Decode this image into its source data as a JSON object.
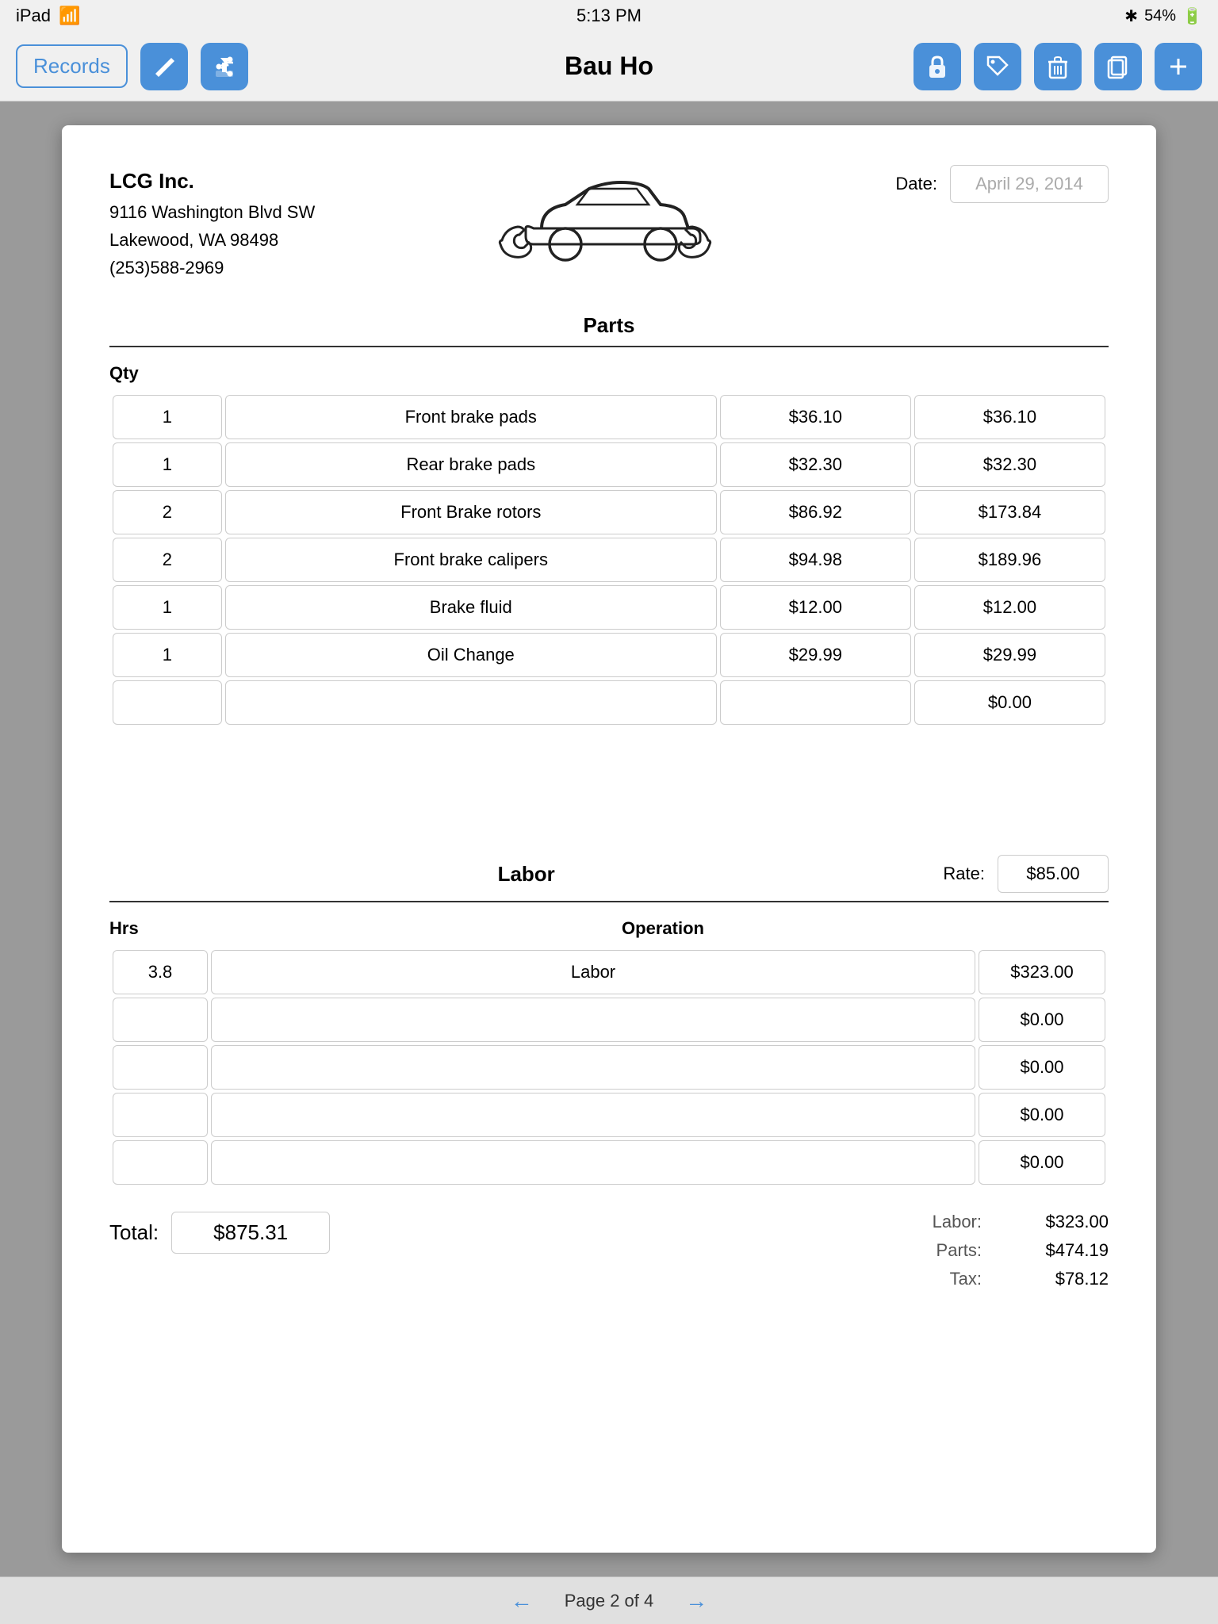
{
  "statusBar": {
    "device": "iPad",
    "wifi": "wifi",
    "time": "5:13 PM",
    "bluetooth": "bluetooth",
    "battery": "54%"
  },
  "navBar": {
    "backLabel": "Records",
    "title": "Bau Ho",
    "icons": [
      "edit",
      "share",
      "lock",
      "tag",
      "trash",
      "copy",
      "add"
    ]
  },
  "company": {
    "name": "LCG Inc.",
    "address1": "9116 Washington Blvd SW",
    "address2": "Lakewood, WA  98498",
    "phone": "(253)588-2969"
  },
  "dateLabel": "Date:",
  "dateValue": "April 29, 2014",
  "parts": {
    "sectionTitle": "Parts",
    "qtyLabel": "Qty",
    "items": [
      {
        "qty": "1",
        "desc": "Front brake pads",
        "unitPrice": "$36.10",
        "total": "$36.10"
      },
      {
        "qty": "1",
        "desc": "Rear brake pads",
        "unitPrice": "$32.30",
        "total": "$32.30"
      },
      {
        "qty": "2",
        "desc": "Front Brake rotors",
        "unitPrice": "$86.92",
        "total": "$173.84"
      },
      {
        "qty": "2",
        "desc": "Front brake calipers",
        "unitPrice": "$94.98",
        "total": "$189.96"
      },
      {
        "qty": "1",
        "desc": "Brake fluid",
        "unitPrice": "$12.00",
        "total": "$12.00"
      },
      {
        "qty": "1",
        "desc": "Oil Change",
        "unitPrice": "$29.99",
        "total": "$29.99"
      },
      {
        "qty": "",
        "desc": "",
        "unitPrice": "",
        "total": "$0.00"
      }
    ]
  },
  "labor": {
    "sectionTitle": "Labor",
    "rateLabel": "Rate:",
    "rateValue": "$85.00",
    "hrsLabel": "Hrs",
    "opLabel": "Operation",
    "items": [
      {
        "hrs": "3.8",
        "operation": "Labor",
        "amount": "$323.00"
      },
      {
        "hrs": "",
        "operation": "",
        "amount": "$0.00"
      },
      {
        "hrs": "",
        "operation": "",
        "amount": "$0.00"
      },
      {
        "hrs": "",
        "operation": "",
        "amount": "$0.00"
      },
      {
        "hrs": "",
        "operation": "",
        "amount": "$0.00"
      }
    ]
  },
  "totals": {
    "totalLabel": "Total:",
    "totalValue": "$875.31",
    "laborLabel": "Labor:",
    "laborValue": "$323.00",
    "partsLabel": "Parts:",
    "partsValue": "$474.19",
    "taxLabel": "Tax:",
    "taxValue": "$78.12"
  },
  "pagination": {
    "label": "Page 2 of 4"
  }
}
